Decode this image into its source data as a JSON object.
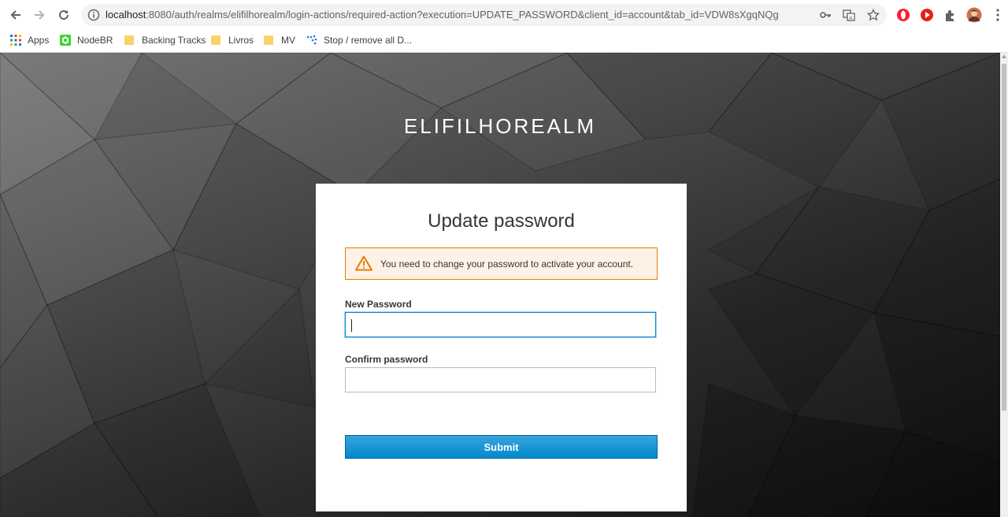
{
  "browser": {
    "url_host": "localhost",
    "url_rest": ":8080/auth/realms/elifilhorealm/login-actions/required-action?execution=UPDATE_PASSWORD&client_id=account&tab_id=VDW8sXgqNQg"
  },
  "bookmarks": [
    {
      "label": "Apps",
      "icon": "apps-grid-icon"
    },
    {
      "label": "NodeBR",
      "icon": "nodebr-icon"
    },
    {
      "label": "Backing Tracks",
      "icon": "folder-icon"
    },
    {
      "label": "Livros",
      "icon": "folder-icon"
    },
    {
      "label": "MV",
      "icon": "folder-icon"
    },
    {
      "label": "Stop / remove all D...",
      "icon": "dots-icon"
    }
  ],
  "page": {
    "realm_name": "ELIFILHOREALM",
    "card_title": "Update password",
    "alert": {
      "text": "You need to change your password to activate your account.",
      "icon": "warning-triangle-icon",
      "color": "#ec7a08"
    },
    "fields": {
      "new_password_label": "New Password",
      "new_password_value": "",
      "confirm_password_label": "Confirm password",
      "confirm_password_value": ""
    },
    "submit_label": "Submit",
    "accent_color": "#0088ce"
  }
}
